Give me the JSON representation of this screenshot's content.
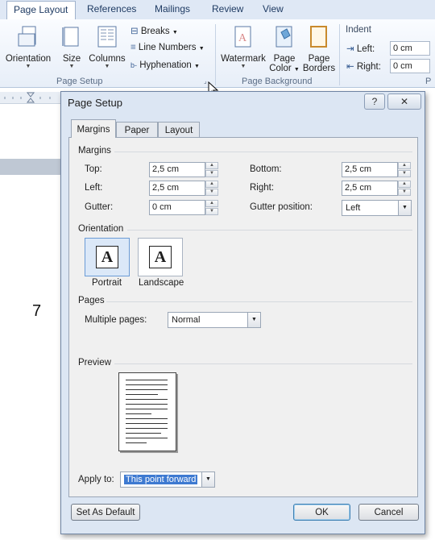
{
  "ribbon": {
    "tabs": [
      "Page Layout",
      "References",
      "Mailings",
      "Review",
      "View"
    ],
    "buttons": {
      "orientation": "Orientation",
      "size": "Size",
      "columns": "Columns",
      "breaks": "Breaks",
      "line_numbers": "Line Numbers",
      "hyphenation": "Hyphenation",
      "watermark": "Watermark",
      "page_color_1": "Page",
      "page_color_2": "Color",
      "page_borders_1": "Page",
      "page_borders_2": "Borders"
    },
    "groups": {
      "page_setup": "Page Setup",
      "page_background": "Page Background",
      "partial": "P"
    },
    "indent": {
      "title": "Indent",
      "left_label": "Left:",
      "left_value": "0 cm",
      "right_label": "Right:",
      "right_value": "0 cm"
    }
  },
  "document": {
    "visible_text": "7"
  },
  "dialog": {
    "title": "Page Setup",
    "title_buttons": {
      "help": "?",
      "close": "✕"
    },
    "tabs": [
      "Margins",
      "Paper",
      "Layout"
    ],
    "margins": {
      "section": "Margins",
      "top_label": "Top:",
      "top_value": "2,5 cm",
      "left_label": "Left:",
      "left_value": "2,5 cm",
      "gutter_label": "Gutter:",
      "gutter_value": "0 cm",
      "bottom_label": "Bottom:",
      "bottom_value": "2,5 cm",
      "right_label": "Right:",
      "right_value": "2,5 cm",
      "gutter_pos_label": "Gutter position:",
      "gutter_pos_value": "Left"
    },
    "orientation": {
      "section": "Orientation",
      "portrait": "Portrait",
      "landscape": "Landscape",
      "glyph": "A"
    },
    "pages": {
      "section": "Pages",
      "multiple_label": "Multiple pages:",
      "multiple_value": "Normal"
    },
    "preview": {
      "section": "Preview"
    },
    "apply": {
      "label": "Apply to:",
      "value": "This point forward"
    },
    "buttons": {
      "set_default": "Set As Default",
      "ok": "OK",
      "cancel": "Cancel"
    }
  }
}
